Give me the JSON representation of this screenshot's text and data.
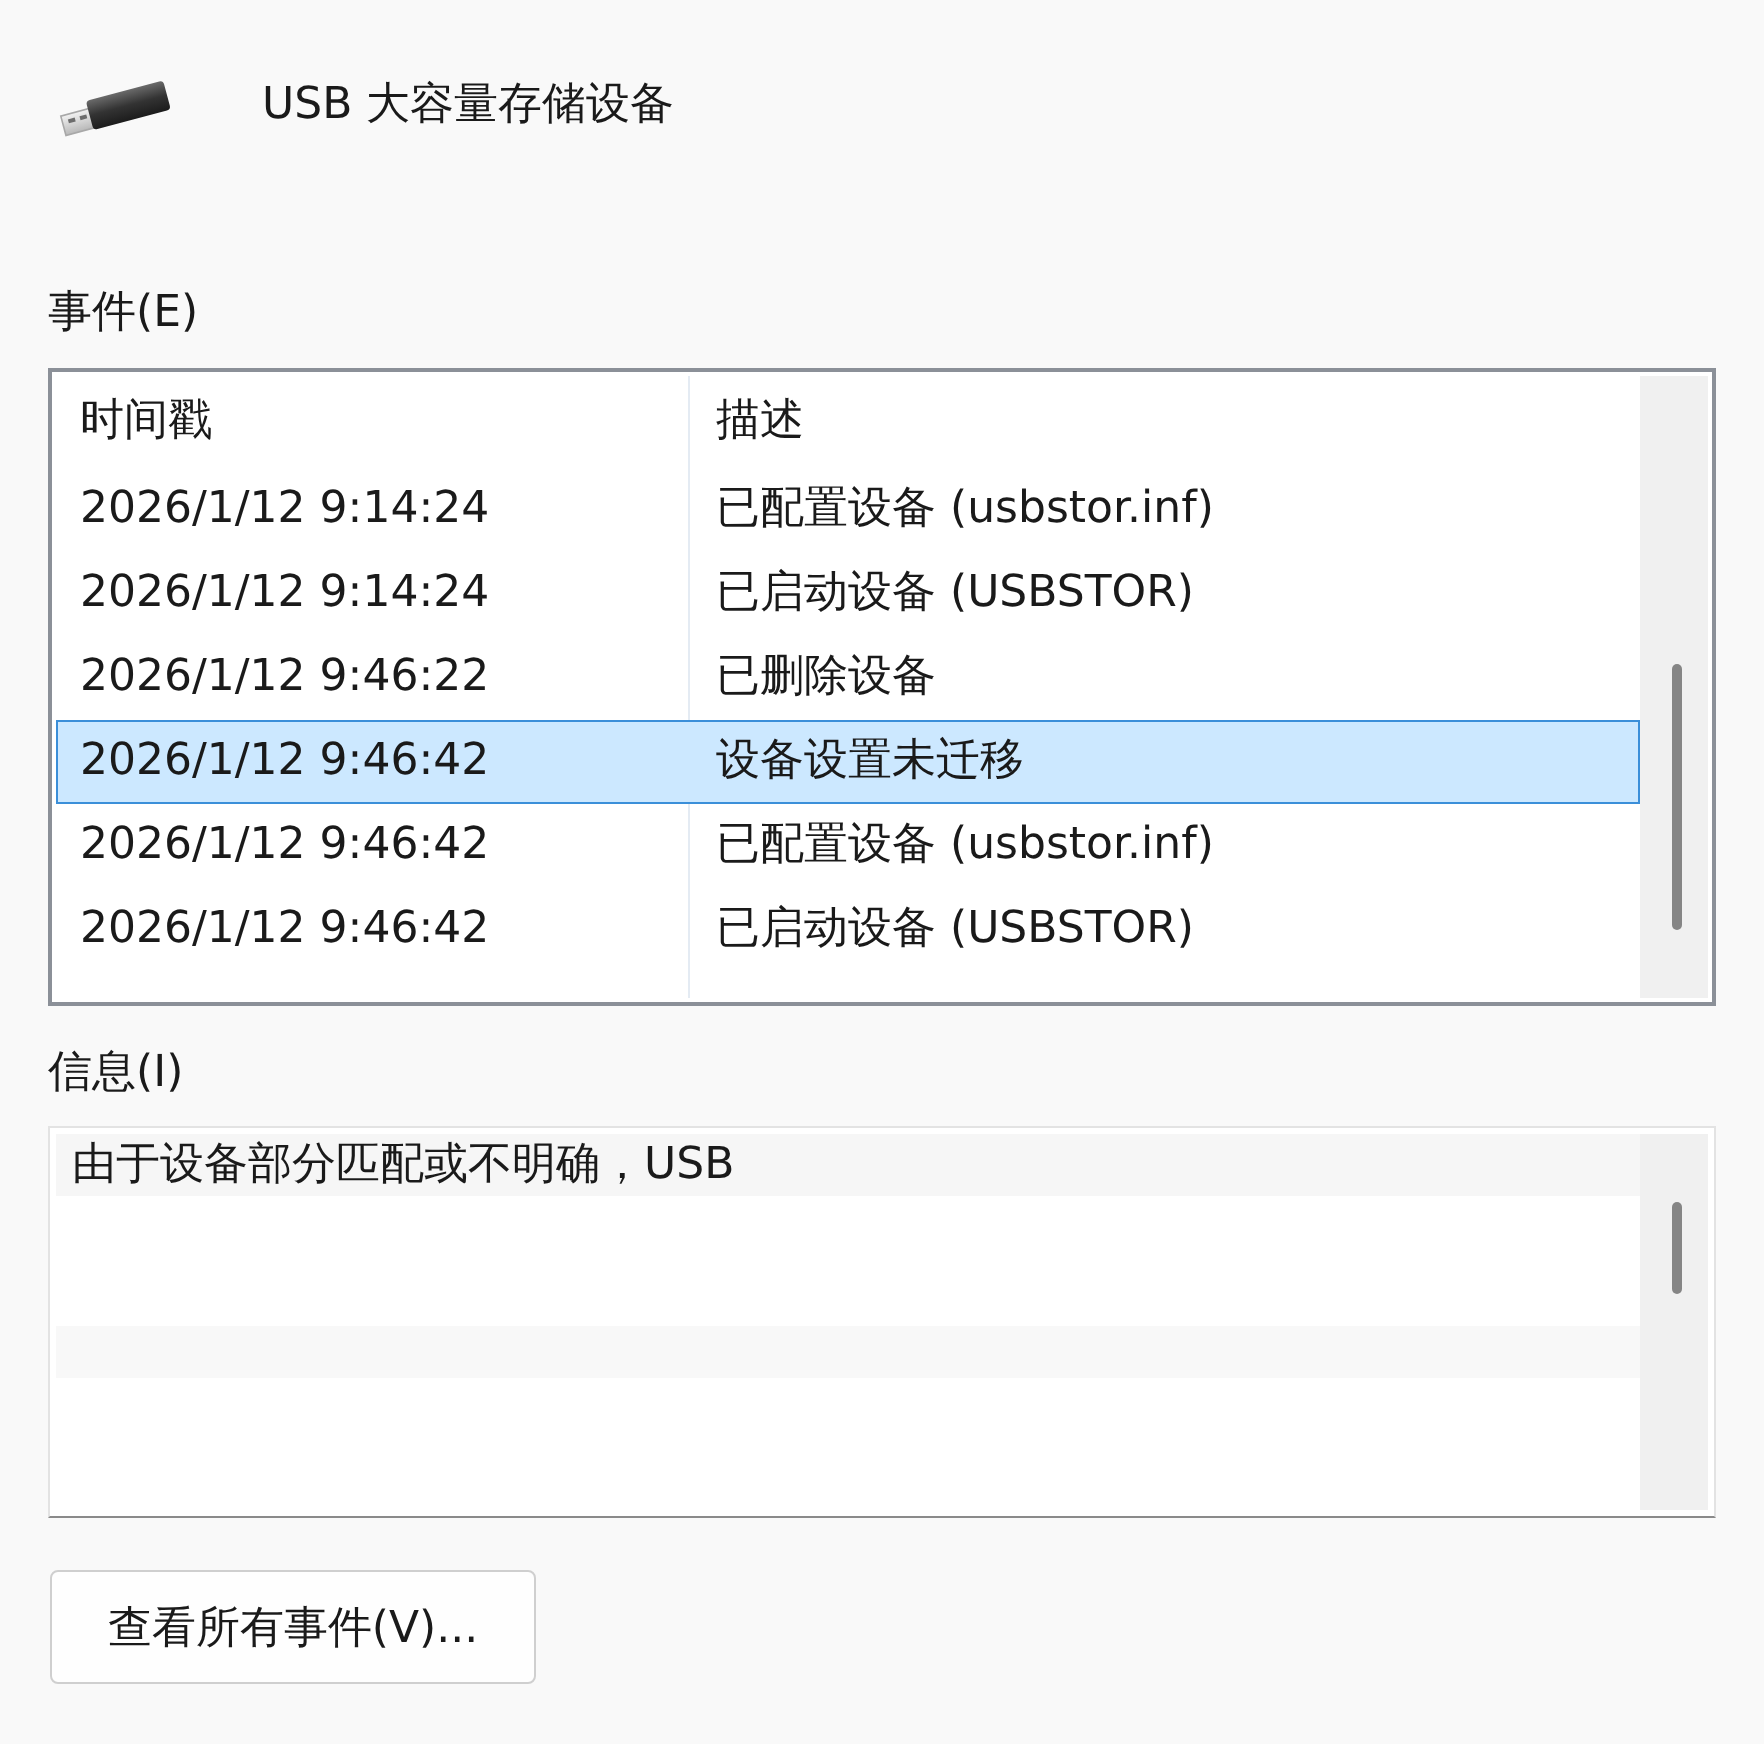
{
  "device": {
    "name": "USB 大容量存储设备"
  },
  "events": {
    "label": "事件(E)",
    "columns": [
      "时间戳",
      "描述"
    ],
    "rows": [
      {
        "timestamp": "2026/1/12 9:14:24",
        "description": "已配置设备 (usbstor.inf)",
        "selected": false
      },
      {
        "timestamp": "2026/1/12 9:14:24",
        "description": "已启动设备 (USBSTOR)",
        "selected": false
      },
      {
        "timestamp": "2026/1/12 9:46:22",
        "description": "已删除设备",
        "selected": false
      },
      {
        "timestamp": "2026/1/12 9:46:42",
        "description": "设备设置未迁移",
        "selected": true
      },
      {
        "timestamp": "2026/1/12 9:46:42",
        "description": "已配置设备 (usbstor.inf)",
        "selected": false
      },
      {
        "timestamp": "2026/1/12 9:46:42",
        "description": "已启动设备 (USBSTOR)",
        "selected": false
      }
    ]
  },
  "information": {
    "label": "信息(I)",
    "text": "由于设备部分匹配或不明确，USB"
  },
  "buttons": [
    {
      "label": "查看所有事件(V)..."
    }
  ]
}
